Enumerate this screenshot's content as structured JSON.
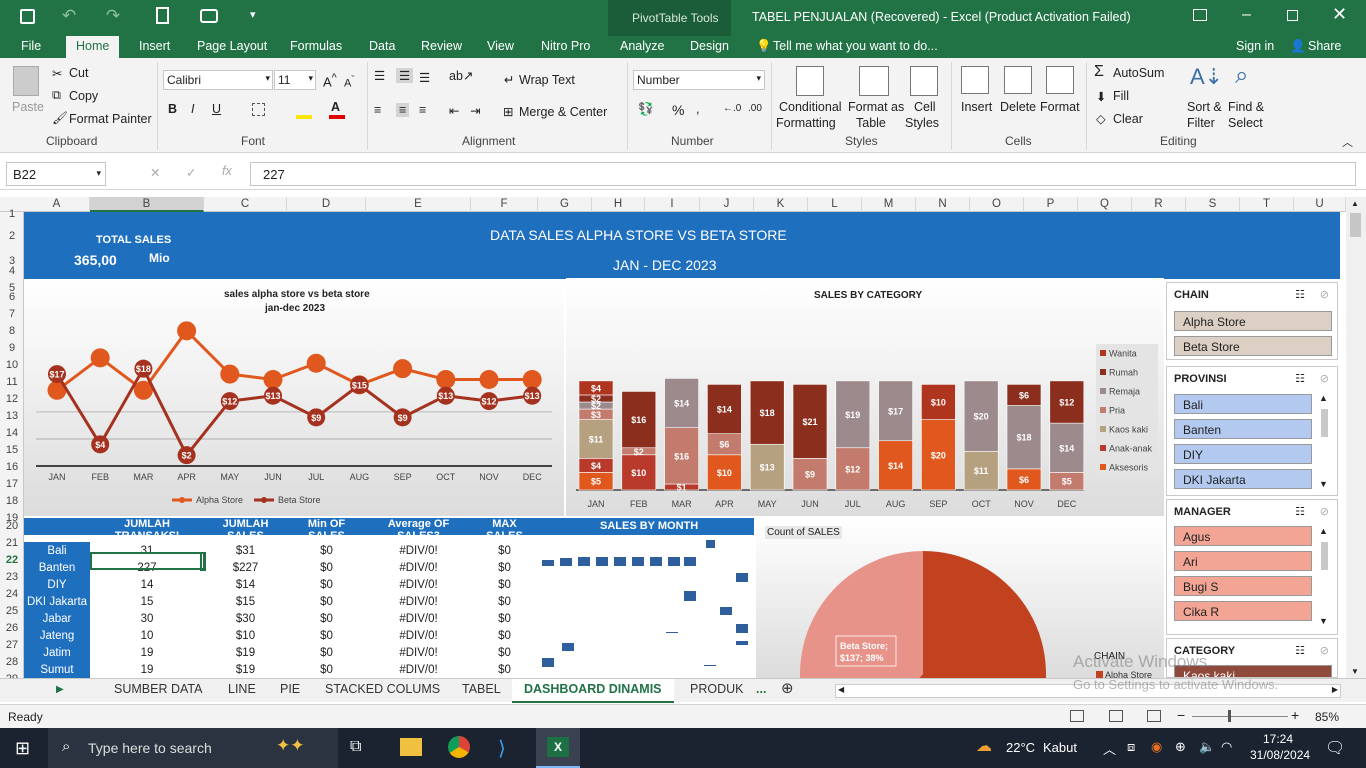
{
  "title_bar": {
    "window_title": "TABEL PENJUALAN (Recovered) - Excel (Product Activation Failed)",
    "context_tab": "PivotTable Tools"
  },
  "menu": [
    "File",
    "Home",
    "Insert",
    "Page Layout",
    "Formulas",
    "Data",
    "Review",
    "View",
    "Nitro Pro",
    "Analyze",
    "Design"
  ],
  "tell_me": "Tell me what you want to do...",
  "sign_in": "Sign in",
  "share": "Share",
  "ribbon": {
    "clipboard": {
      "paste": "Paste",
      "cut": "Cut",
      "copy": "Copy",
      "format_painter": "Format Painter",
      "group": "Clipboard"
    },
    "font": {
      "name": "Calibri",
      "size": "11",
      "group": "Font",
      "bold": "B",
      "italic": "I",
      "underline": "U"
    },
    "alignment": {
      "wrap": "Wrap Text",
      "merge": "Merge & Center",
      "group": "Alignment"
    },
    "number": {
      "format": "Number",
      "group": "Number",
      "percent": "%"
    },
    "styles": {
      "cond": [
        "Conditional",
        "Formatting"
      ],
      "fmt_table": [
        "Format as",
        "Table"
      ],
      "cell_styles": [
        "Cell",
        "Styles"
      ],
      "group": "Styles"
    },
    "cells": {
      "insert": "Insert",
      "delete": "Delete",
      "format": "Format",
      "group": "Cells"
    },
    "editing": {
      "autosum": "AutoSum",
      "fill": "Fill",
      "clear": "Clear",
      "sort": [
        "Sort &",
        "Filter"
      ],
      "find": [
        "Find &",
        "Select"
      ],
      "group": "Editing"
    }
  },
  "formula_bar": {
    "name_box": "B22",
    "formula": "227"
  },
  "columns": [
    "A",
    "B",
    "C",
    "D",
    "E",
    "F",
    "G",
    "H",
    "I",
    "J",
    "K",
    "L",
    "M",
    "N",
    "O",
    "P",
    "Q",
    "R",
    "S",
    "T",
    "U"
  ],
  "rows": [
    "1",
    "2",
    "3",
    "4",
    "5",
    "6",
    "7",
    "8",
    "9",
    "10",
    "11",
    "12",
    "13",
    "14",
    "15",
    "16",
    "17",
    "18",
    "19",
    "20",
    "21",
    "22",
    "23",
    "24",
    "25",
    "26",
    "27",
    "28",
    "29"
  ],
  "dashboard": {
    "total_label": "TOTAL SALES",
    "total_value": "365,00",
    "total_unit": "Mio",
    "title": "DATA SALES ALPHA STORE VS BETA STORE",
    "subtitle": "JAN - DEC 2023"
  },
  "chart_data": [
    {
      "type": "line",
      "title": "sales alpha store vs beta store",
      "subtitle": "jan-dec 2023",
      "categories": [
        "JAN",
        "FEB",
        "MAR",
        "APR",
        "MAY",
        "JUN",
        "JUL",
        "AUG",
        "SEP",
        "OCT",
        "NOV",
        "DEC"
      ],
      "series": [
        {
          "name": "Alpha Store",
          "values": [
            14,
            20,
            14,
            25,
            17,
            16,
            19,
            15,
            18,
            16,
            16,
            16
          ]
        },
        {
          "name": "Beta Store",
          "values": [
            17,
            4,
            18,
            2,
            12,
            13,
            9,
            15,
            9,
            13,
            12,
            13
          ]
        }
      ],
      "data_labels": "Beta Store",
      "colors": {
        "Alpha Store": "#e0581e",
        "Beta Store": "#a5321f"
      },
      "legend": "bottom",
      "ylim": [
        0,
        27
      ]
    },
    {
      "type": "bar",
      "stacked": true,
      "title": "SALES BY CATEGORY",
      "categories": [
        "JAN",
        "FEB",
        "MAR",
        "APR",
        "MAY",
        "JUN",
        "JUL",
        "AUG",
        "SEP",
        "OCT",
        "NOV",
        "DEC"
      ],
      "series": [
        {
          "name": "Aksesoris",
          "color": "#e0581e",
          "values": [
            5,
            0,
            0,
            10,
            0,
            0,
            0,
            14,
            20,
            0,
            6,
            0
          ]
        },
        {
          "name": "Anak-anak",
          "color": "#b93a2b",
          "values": [
            4,
            10,
            1,
            0,
            0,
            0,
            0,
            0,
            0,
            0,
            0,
            0
          ]
        },
        {
          "name": "Kaos kaki",
          "color": "#b5a080",
          "values": [
            11,
            0,
            0,
            0,
            13,
            0,
            0,
            0,
            0,
            11,
            0,
            0
          ]
        },
        {
          "name": "Pria",
          "color": "#c27b6c",
          "values": [
            3,
            2,
            16,
            6,
            0,
            9,
            12,
            0,
            0,
            0,
            0,
            5
          ]
        },
        {
          "name": "Remaja",
          "color": "#9c8a8d",
          "values": [
            2,
            0,
            14,
            0,
            0,
            0,
            19,
            17,
            0,
            20,
            18,
            14
          ]
        },
        {
          "name": "Rumah",
          "color": "#8c2e1e",
          "values": [
            2,
            16,
            0,
            14,
            18,
            21,
            0,
            0,
            0,
            0,
            6,
            12
          ]
        },
        {
          "name": "Wanita",
          "color": "#b0351f",
          "values": [
            4,
            0,
            0,
            0,
            0,
            0,
            0,
            0,
            10,
            0,
            0,
            0
          ]
        }
      ],
      "legend": "right"
    },
    {
      "type": "pie",
      "title": "Count of SALES",
      "slices": [
        {
          "name": "Beta Store",
          "value": 137,
          "label": "Beta Store;\n$137; 38%",
          "color": "#e8938a"
        },
        {
          "name": "Alpha Store",
          "value": 228,
          "color": "#c24220"
        }
      ],
      "legend_title": "CHAIN"
    },
    {
      "type": "table",
      "title": "SALES BY MONTH",
      "headers": [
        "",
        "JUMLAH TRANSAKSI",
        "JUMLAH SALES",
        "Min OF SALES",
        "Average OF SALES3",
        "MAX SALES"
      ],
      "rows": [
        [
          "Bali",
          "31",
          "$31",
          "$0",
          "#DIV/0!",
          "$0"
        ],
        [
          "Banten",
          "227",
          "$227",
          "$0",
          "#DIV/0!",
          "$0"
        ],
        [
          "DIY",
          "14",
          "$14",
          "$0",
          "#DIV/0!",
          "$0"
        ],
        [
          "DKI Jakarta",
          "15",
          "$15",
          "$0",
          "#DIV/0!",
          "$0"
        ],
        [
          "Jabar",
          "30",
          "$30",
          "$0",
          "#DIV/0!",
          "$0"
        ],
        [
          "Jateng",
          "10",
          "$10",
          "$0",
          "#DIV/0!",
          "$0"
        ],
        [
          "Jatim",
          "19",
          "$19",
          "$0",
          "#DIV/0!",
          "$0"
        ],
        [
          "Sumut",
          "19",
          "$19",
          "$0",
          "#DIV/0!",
          "$0"
        ]
      ]
    }
  ],
  "slicers": {
    "chain": {
      "title": "CHAIN",
      "items": [
        "Alpha Store",
        "Beta Store"
      ]
    },
    "provinsi": {
      "title": "PROVINSI",
      "items": [
        "Bali",
        "Banten",
        "DIY",
        "DKI Jakarta"
      ]
    },
    "manager": {
      "title": "MANAGER",
      "items": [
        "Agus",
        "Ari",
        "Bugi S",
        "Cika R"
      ]
    },
    "category": {
      "title": "CATEGORY",
      "items": [
        "Kaos kaki"
      ]
    }
  },
  "sheet_tabs": [
    "SUMBER DATA",
    "LINE",
    "PIE",
    "STACKED COLUMS",
    "TABEL",
    "DASHBOARD DINAMIS",
    "PRODUK",
    "..."
  ],
  "active_tab": "DASHBOARD DINAMIS",
  "status": {
    "ready": "Ready",
    "zoom": "85%"
  },
  "watermark": {
    "line1": "Activate Windows",
    "line2": "Go to Settings to activate Windows."
  },
  "taskbar": {
    "search": "Type here to search",
    "weather_temp": "22°C",
    "weather_desc": "Kabut",
    "time": "17:24",
    "date": "31/08/2024"
  }
}
